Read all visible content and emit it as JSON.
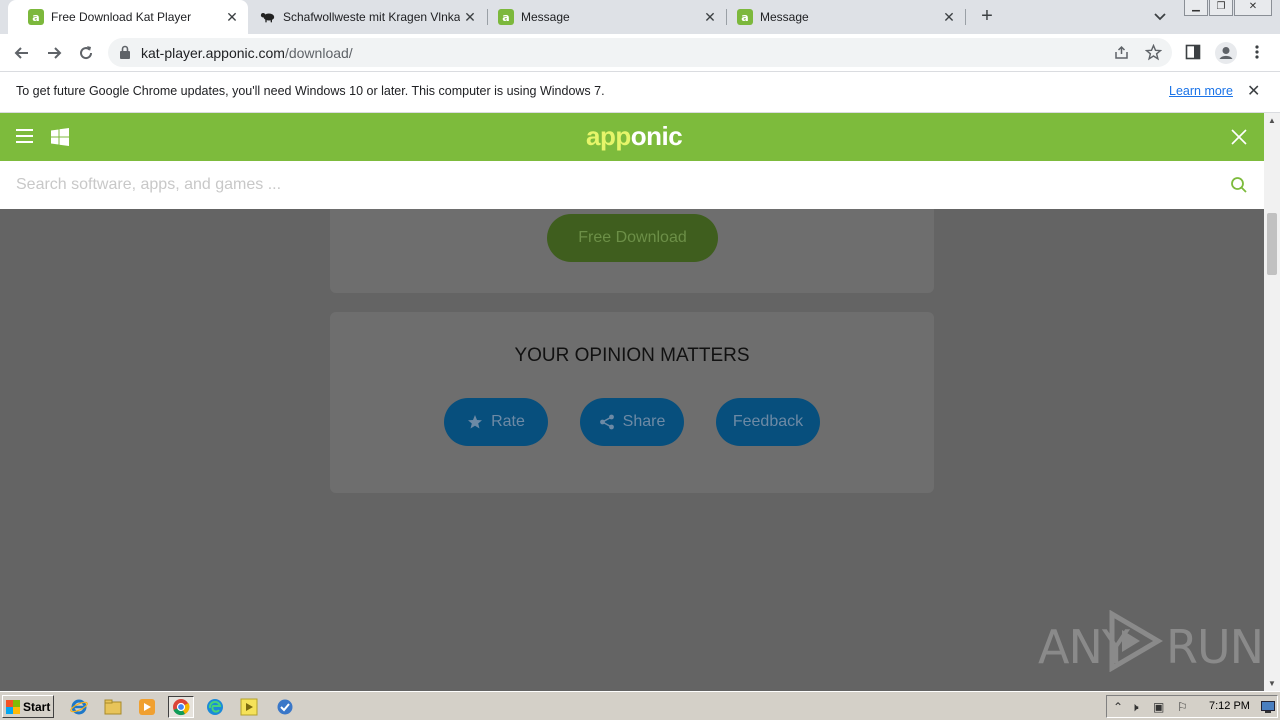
{
  "browser": {
    "tabs": [
      {
        "title": "Free Download Kat Player",
        "favicon": "apponic-icon",
        "active": true
      },
      {
        "title": "Schafwollweste mit Kragen Vlnka - W",
        "favicon": "sheep-icon",
        "active": false
      },
      {
        "title": "Message",
        "favicon": "apponic-icon",
        "active": false
      },
      {
        "title": "Message",
        "favicon": "apponic-icon",
        "active": false
      }
    ],
    "favicon_letter": "a",
    "url_host": "kat-player.apponic.com",
    "url_path": "/download/"
  },
  "infobar": {
    "message": "To get future Google Chrome updates, you'll need Windows 10 or later. This computer is using Windows 7.",
    "link": "Learn more"
  },
  "site": {
    "logo_part1": "app",
    "logo_part2": "onic",
    "search_placeholder": "Search software, apps, and games ...",
    "download_button": "Free Download",
    "opinion_title": "YOUR OPINION MATTERS",
    "buttons": {
      "rate": "Rate",
      "share": "Share",
      "feedback": "Feedback"
    },
    "colors": {
      "brand_green": "#7dbb3c",
      "button_blue": "#074f7d",
      "overlay": "#646464"
    }
  },
  "watermark": {
    "text_left": "ANY",
    "text_right": "RUN"
  },
  "taskbar": {
    "start_label": "Start",
    "clock": "7:12 PM"
  }
}
